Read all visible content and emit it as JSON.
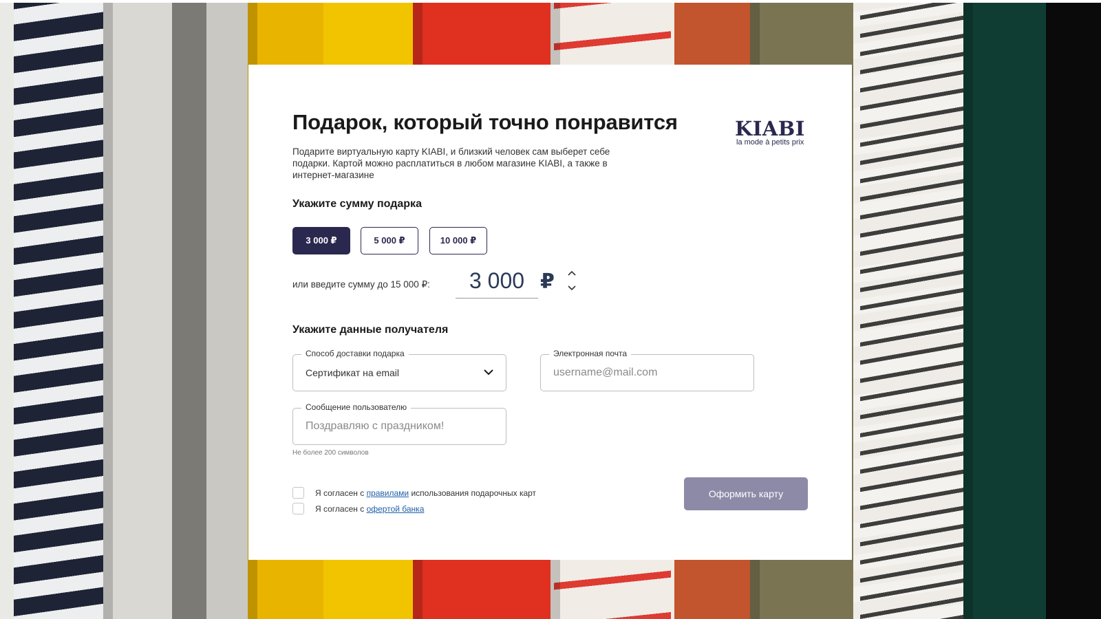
{
  "card": {
    "title": "Подарок, который точно понравится",
    "description": "Подарите виртуальную карту KIABI, и близкий человек сам выберет себе подарки. Картой можно расплатиться в любом магазине KIABI, а также в интернет-магазине",
    "logo": {
      "brand": "KIABI",
      "tagline": "la mode à petits prix"
    }
  },
  "amount": {
    "heading": "Укажите сумму подарка",
    "options": [
      "3 000 ₽",
      "5 000 ₽",
      "10 000 ₽"
    ],
    "selected_index": 0,
    "custom_label": "или введите сумму до 15 000 ₽:",
    "custom_value": "3 000",
    "currency": "₽"
  },
  "recipient": {
    "heading": "Укажите данные получателя",
    "delivery": {
      "label": "Способ доставки подарка",
      "value": "Сертификат на email"
    },
    "email": {
      "label": "Электронная почта",
      "placeholder": "username@mail.com"
    },
    "message": {
      "label": "Сообщение пользователю",
      "placeholder": "Поздравляю с праздником!",
      "hint": "Не более 200 символов"
    }
  },
  "agreements": [
    {
      "prefix": "Я согласен с ",
      "link": "правилами",
      "suffix": " использования подарочных карт"
    },
    {
      "prefix": "Я согласен с ",
      "link": "офертой банка",
      "suffix": ""
    }
  ],
  "submit_label": "Оформить карту",
  "colors": {
    "brand": "#2b2850",
    "submit_disabled": "#8d8aa7",
    "link": "#1f5fa8"
  }
}
